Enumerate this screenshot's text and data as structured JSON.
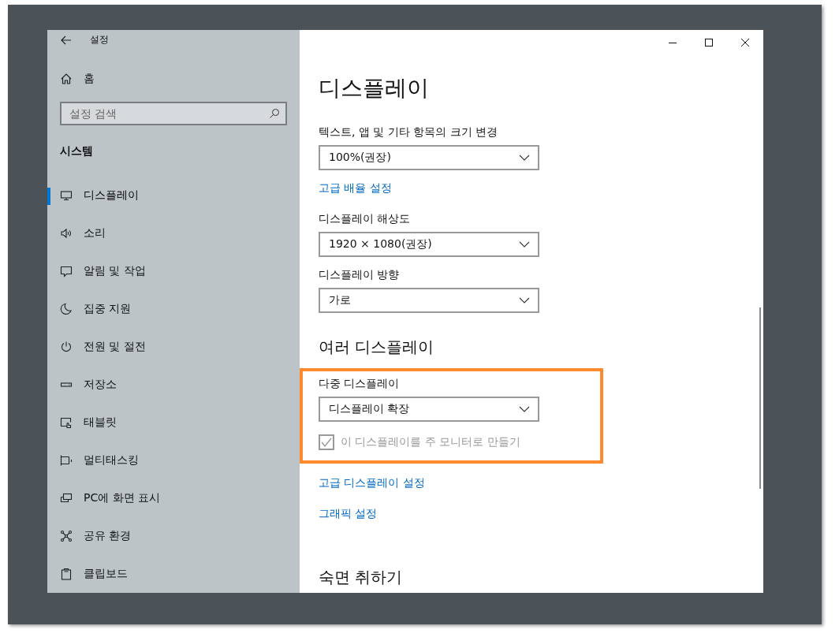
{
  "window": {
    "title": "설정"
  },
  "sidebar": {
    "home": "홈",
    "search": {
      "placeholder": "설정 검색"
    },
    "section": "시스템",
    "items": [
      {
        "label": "디스플레이",
        "selected": true
      },
      {
        "label": "소리",
        "selected": false
      },
      {
        "label": "알림 및 작업",
        "selected": false
      },
      {
        "label": "집중 지원",
        "selected": false
      },
      {
        "label": "전원 및 절전",
        "selected": false
      },
      {
        "label": "저장소",
        "selected": false
      },
      {
        "label": "태블릿",
        "selected": false
      },
      {
        "label": "멀티태스킹",
        "selected": false
      },
      {
        "label": "PC에 화면 표시",
        "selected": false
      },
      {
        "label": "공유 환경",
        "selected": false
      },
      {
        "label": "클립보드",
        "selected": false
      }
    ]
  },
  "content": {
    "title": "디스플레이",
    "blocks": [
      {
        "kind": "label",
        "text": "텍스트, 앱 및 기타 항목의 크기 변경"
      },
      {
        "kind": "dropdown",
        "value": "100%(권장)"
      },
      {
        "kind": "link",
        "text": "고급 배율 설정"
      },
      {
        "kind": "label",
        "text": "디스플레이 해상도"
      },
      {
        "kind": "dropdown",
        "value": "1920 × 1080(권장)"
      },
      {
        "kind": "label",
        "text": "디스플레이 방향"
      },
      {
        "kind": "dropdown",
        "value": "가로"
      },
      {
        "kind": "heading",
        "text": "여러 디스플레이"
      },
      {
        "kind": "label",
        "text": "다중 디스플레이",
        "highlighted": true
      },
      {
        "kind": "dropdown",
        "value": "디스플레이 확장",
        "highlighted": true
      },
      {
        "kind": "checkbox",
        "text": "이 디스플레이를 주 모니터로 만들기",
        "checked": true,
        "disabled": true,
        "highlighted": true
      },
      {
        "kind": "link",
        "text": "고급 디스플레이 설정"
      },
      {
        "kind": "link",
        "text": "그래픽 설정"
      },
      {
        "kind": "heading",
        "text": "숙면 취하기"
      }
    ]
  }
}
